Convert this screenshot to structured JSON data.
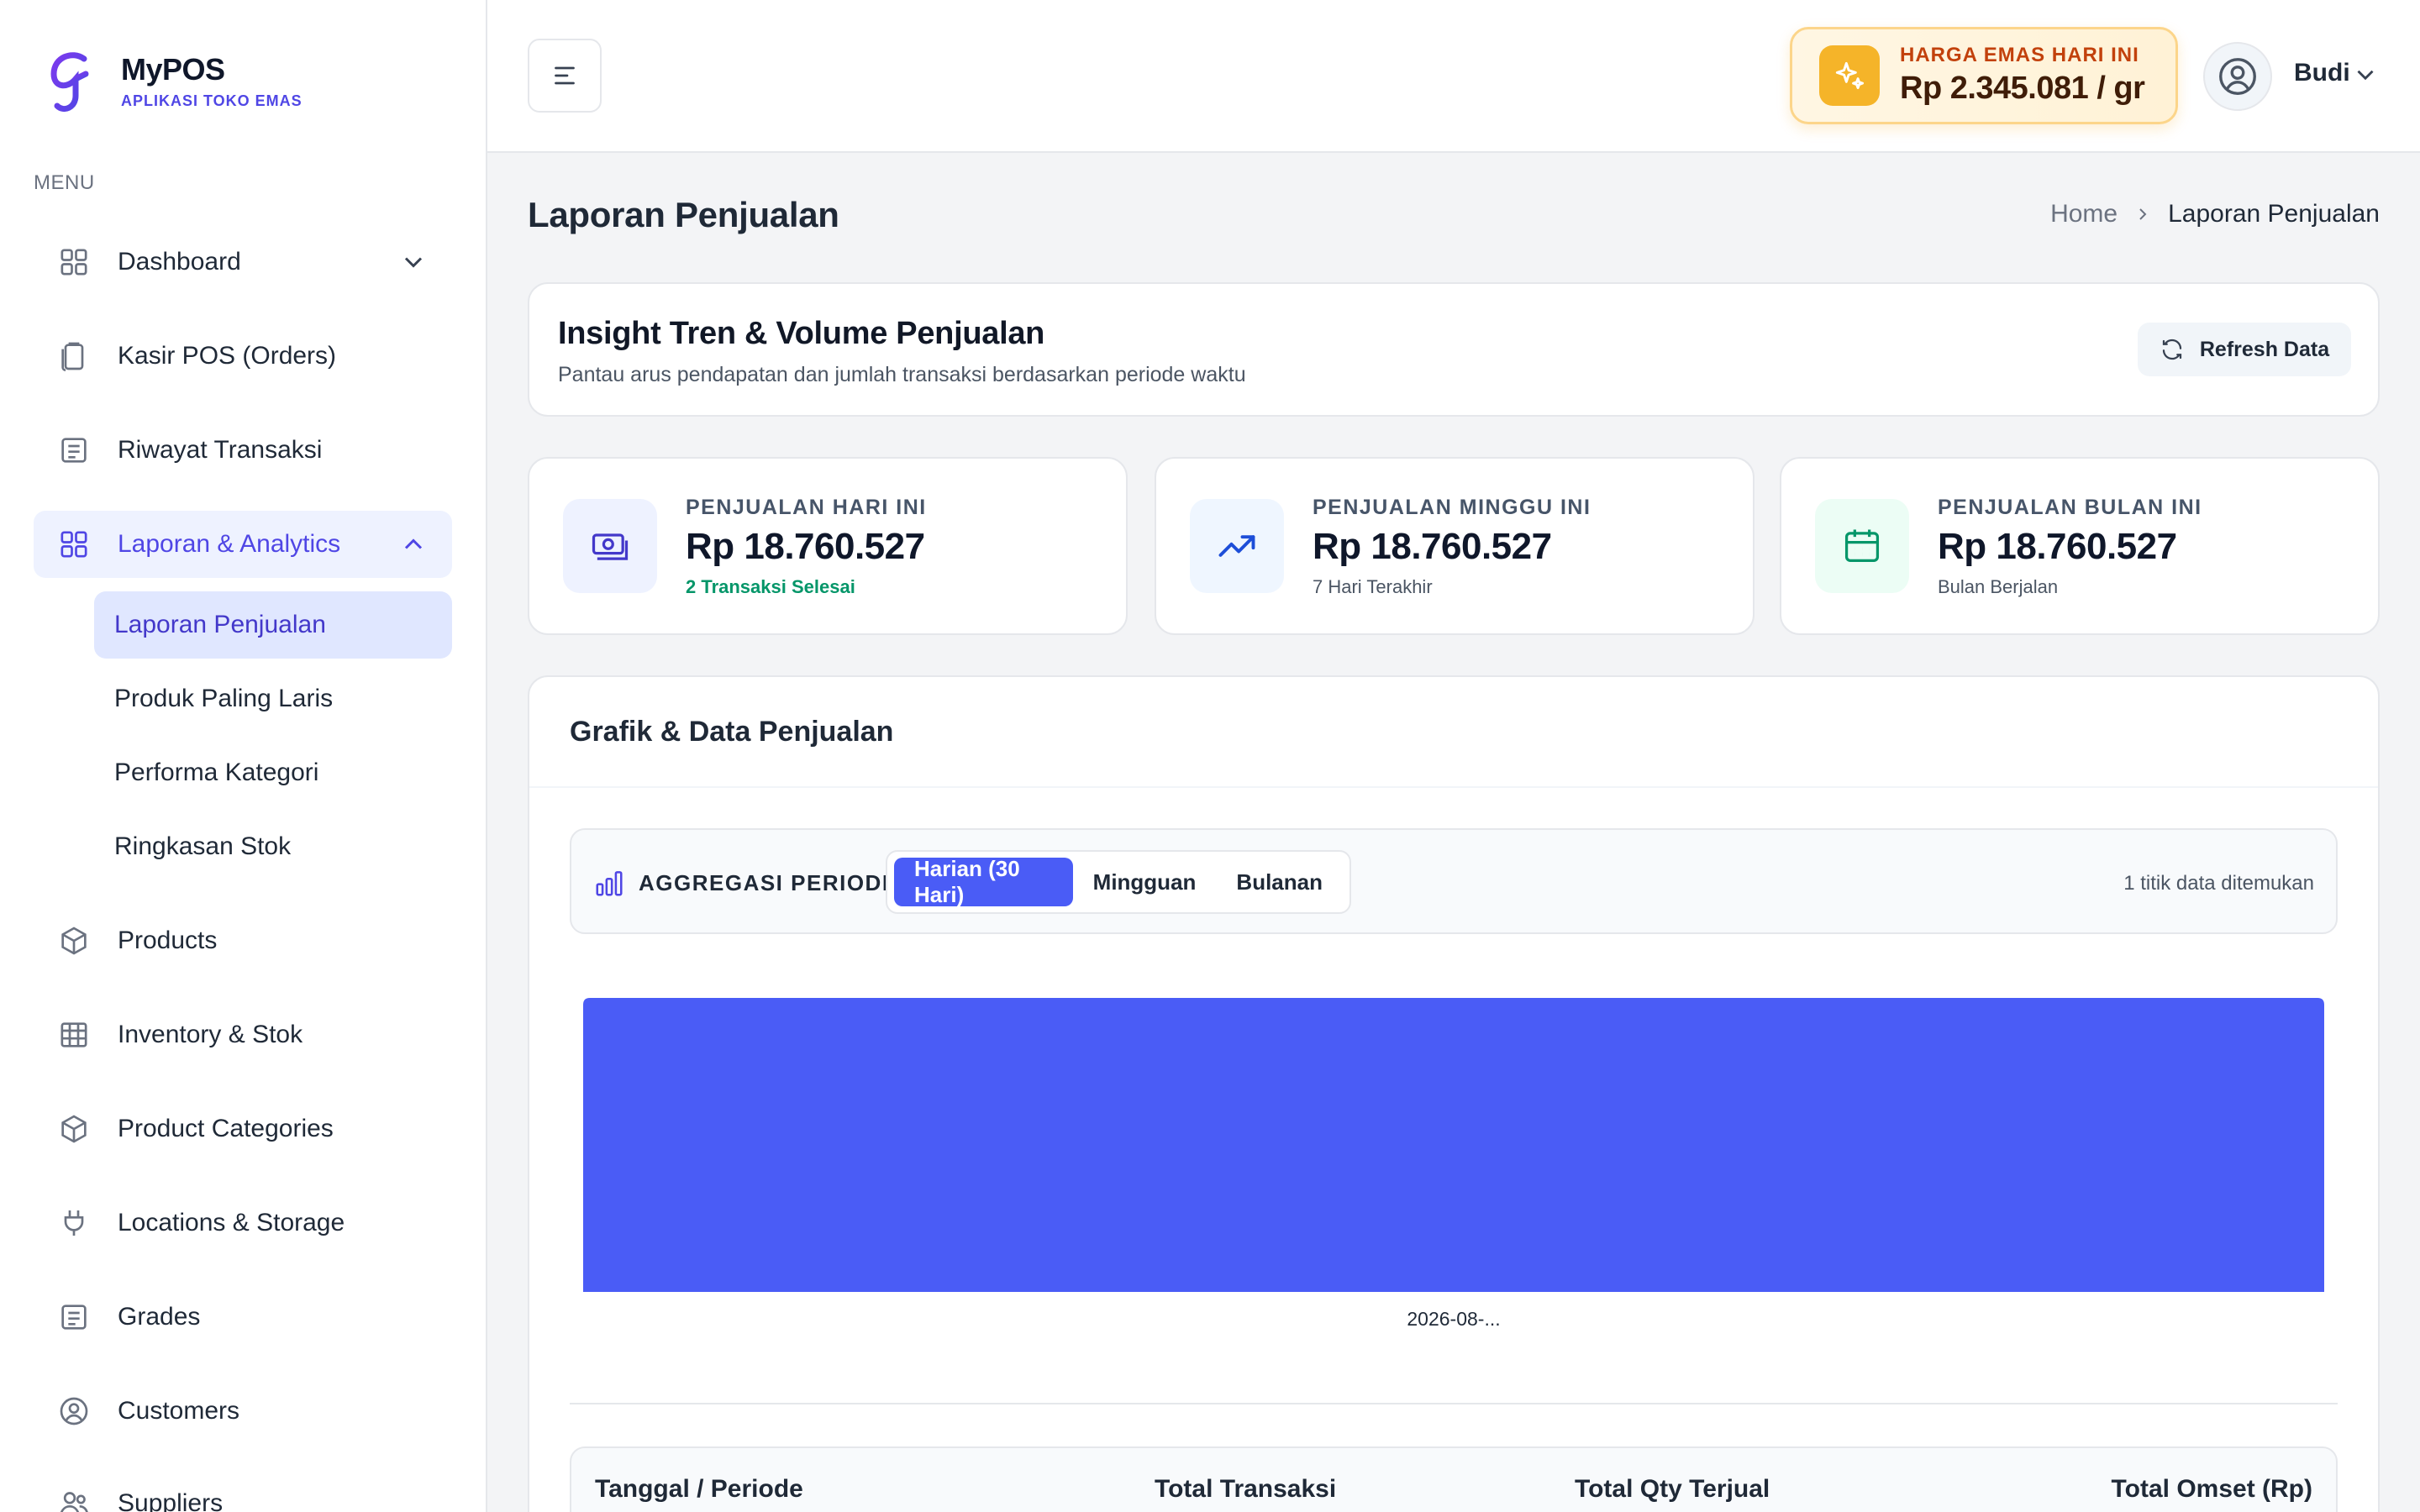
{
  "brand": {
    "name": "MyPOS",
    "subtitle": "APLIKASI TOKO EMAS"
  },
  "sidebar": {
    "menu_heading": "MENU",
    "items": [
      {
        "label": "Dashboard",
        "icon": "grid-icon"
      },
      {
        "label": "Kasir POS (Orders)",
        "icon": "clipboard-icon"
      },
      {
        "label": "Riwayat Transaksi",
        "icon": "document-icon"
      },
      {
        "label": "Laporan & Analytics",
        "icon": "grid-icon",
        "active": true
      },
      {
        "label": "Products",
        "icon": "cube-icon"
      },
      {
        "label": "Inventory & Stok",
        "icon": "table-icon"
      },
      {
        "label": "Product Categories",
        "icon": "cube-icon"
      },
      {
        "label": "Locations & Storage",
        "icon": "plug-icon"
      },
      {
        "label": "Grades",
        "icon": "document-icon"
      },
      {
        "label": "Customers",
        "icon": "user-circle-icon"
      },
      {
        "label": "Suppliers",
        "icon": "users-icon"
      }
    ],
    "subitems": [
      {
        "label": "Laporan Penjualan",
        "active": true
      },
      {
        "label": "Produk Paling Laris"
      },
      {
        "label": "Performa Kategori"
      },
      {
        "label": "Ringkasan Stok"
      }
    ]
  },
  "header": {
    "gold_label": "HARGA EMAS HARI INI",
    "gold_value": "Rp 2.345.081 / gr",
    "user_name": "Budi"
  },
  "page": {
    "title": "Laporan Penjualan",
    "breadcrumb": {
      "home": "Home",
      "current": "Laporan Penjualan"
    }
  },
  "insight": {
    "title": "Insight Tren & Volume Penjualan",
    "subtitle": "Pantau arus pendapatan dan jumlah transaksi berdasarkan periode waktu",
    "refresh_label": "Refresh Data"
  },
  "stats": [
    {
      "label": "PENJUALAN HARI INI",
      "value": "Rp 18.760.527",
      "note": "2 Transaksi Selesai",
      "icon": "money-icon"
    },
    {
      "label": "PENJUALAN MINGGU INI",
      "value": "Rp 18.760.527",
      "note": "7 Hari Terakhir",
      "icon": "trend-up-icon"
    },
    {
      "label": "PENJUALAN BULAN INI",
      "value": "Rp 18.760.527",
      "note": "Bulan Berjalan",
      "icon": "calendar-icon"
    }
  ],
  "graph": {
    "title": "Grafik & Data Penjualan",
    "period_label": "AGGREGASI PERIODE:",
    "tabs": [
      "Harian (30 Hari)",
      "Mingguan",
      "Bulanan"
    ],
    "active_tab": "Harian (30 Hari)",
    "count_text": "1 titik data ditemukan"
  },
  "chart_data": {
    "type": "bar",
    "categories": [
      "2026-08-..."
    ],
    "values": [
      18760527
    ],
    "color": "#4a5cf6"
  },
  "table": {
    "headers": [
      "Tanggal / Periode",
      "Total Transaksi",
      "Total Qty Terjual",
      "Total Omset (Rp)"
    ]
  },
  "colors": {
    "accent": "#4f46e5",
    "bar": "#4a5cf6",
    "gold": "#f5b429",
    "success": "#059669"
  }
}
